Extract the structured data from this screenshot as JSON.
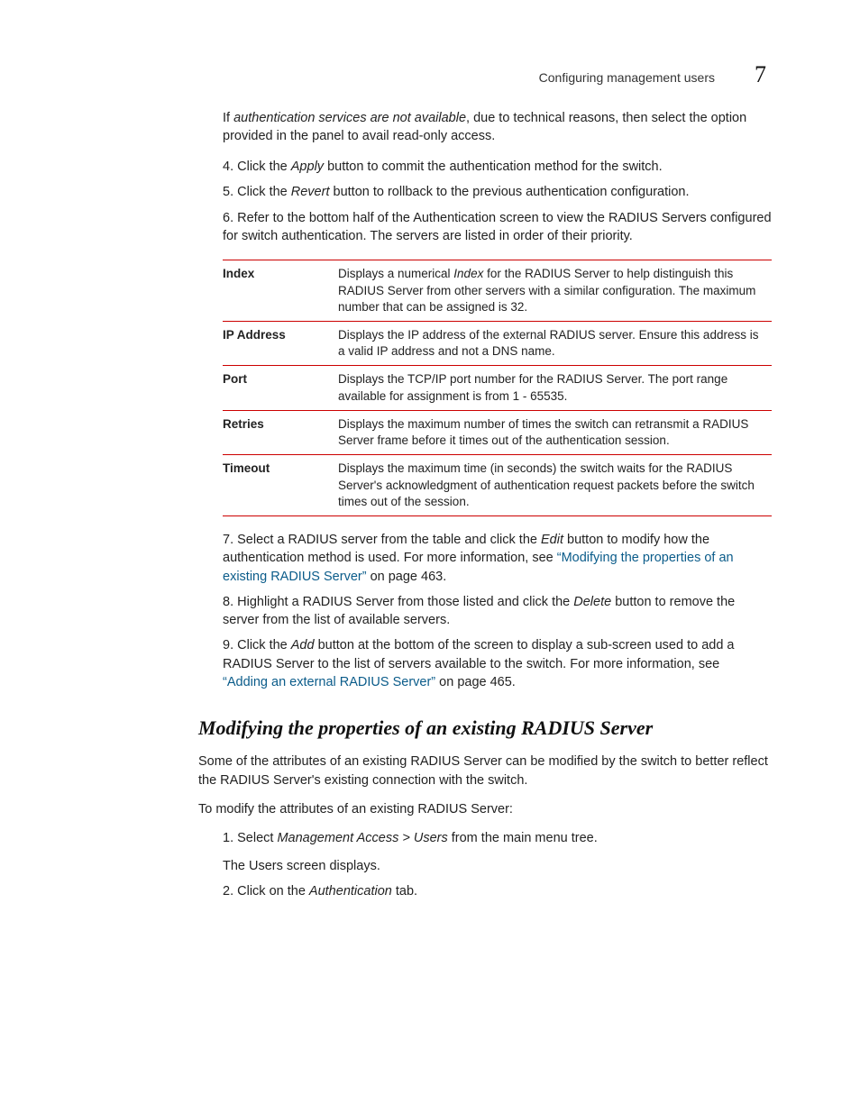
{
  "header": {
    "section_title": "Configuring management users",
    "chapter_number": "7"
  },
  "intro": {
    "lead_text": "If ",
    "lead_italic": "authentication services are not available",
    "lead_rest": ", due to technical reasons, then select the option provided in the panel to avail read-only access."
  },
  "steps_a": [
    {
      "num": "4.",
      "pre": "Click the ",
      "it": "Apply",
      "post": " button to commit the authentication method for the switch."
    },
    {
      "num": "5.",
      "pre": "Click the ",
      "it": "Revert",
      "post": " button to rollback to the previous authentication configuration."
    },
    {
      "num": "6.",
      "pre": "",
      "it": "",
      "post": "Refer to the bottom half of the Authentication screen to view the RADIUS Servers configured for switch authentication. The servers are listed in order of their priority."
    }
  ],
  "table": [
    {
      "term": "Index",
      "desc_pre": "Displays a numerical ",
      "desc_it": "Index",
      "desc_post": " for the RADIUS Server to help distinguish this RADIUS Server from other servers with a similar configuration. The maximum number that can be assigned is 32."
    },
    {
      "term": "IP Address",
      "desc_pre": "",
      "desc_it": "",
      "desc_post": "Displays the IP address of the external RADIUS server. Ensure this address is a valid IP address and not a DNS name."
    },
    {
      "term": "Port",
      "desc_pre": "",
      "desc_it": "",
      "desc_post": "Displays the TCP/IP port number for the RADIUS Server. The port range available for assignment is from 1 - 65535."
    },
    {
      "term": "Retries",
      "desc_pre": "",
      "desc_it": "",
      "desc_post": "Displays the maximum number of times the switch can retransmit a RADIUS Server frame before it times out of the authentication session."
    },
    {
      "term": "Timeout",
      "desc_pre": "",
      "desc_it": "",
      "desc_post": "Displays the maximum time (in seconds) the switch waits for the RADIUS Server's acknowledgment of authentication request packets before the switch times out of the session."
    }
  ],
  "steps_b": [
    {
      "pre": "Select a RADIUS server from the table and click the ",
      "it": "Edit",
      "post": " button to modify how the authentication method is used. For more information, see ",
      "link": "“Modifying the properties of an existing RADIUS Server”",
      "post2": " on page 463."
    },
    {
      "pre": "Highlight a RADIUS Server from those listed and click the ",
      "it": "Delete",
      "post": " button to remove the server from the list of available servers.",
      "link": "",
      "post2": ""
    },
    {
      "pre": "Click the ",
      "it": "Add",
      "post": " button at the bottom of the screen to display a sub-screen used to add a RADIUS Server to the list of servers available to the switch. For more information, see ",
      "link": "“Adding an external RADIUS Server”",
      "post2": " on page 465."
    }
  ],
  "section2": {
    "heading": "Modifying the properties of an existing RADIUS Server",
    "para1": "Some of the attributes of an existing RADIUS Server can be modified by the switch to better reflect the RADIUS Server's existing connection with the switch.",
    "para2": "To modify the attributes of an existing RADIUS Server:",
    "steps": [
      {
        "pre": "Select ",
        "it": "Management Access > Users",
        "post": " from the main menu tree.",
        "follow": "The Users screen displays."
      },
      {
        "pre": "Click on the ",
        "it": "Authentication",
        "post": " tab.",
        "follow": ""
      }
    ]
  }
}
